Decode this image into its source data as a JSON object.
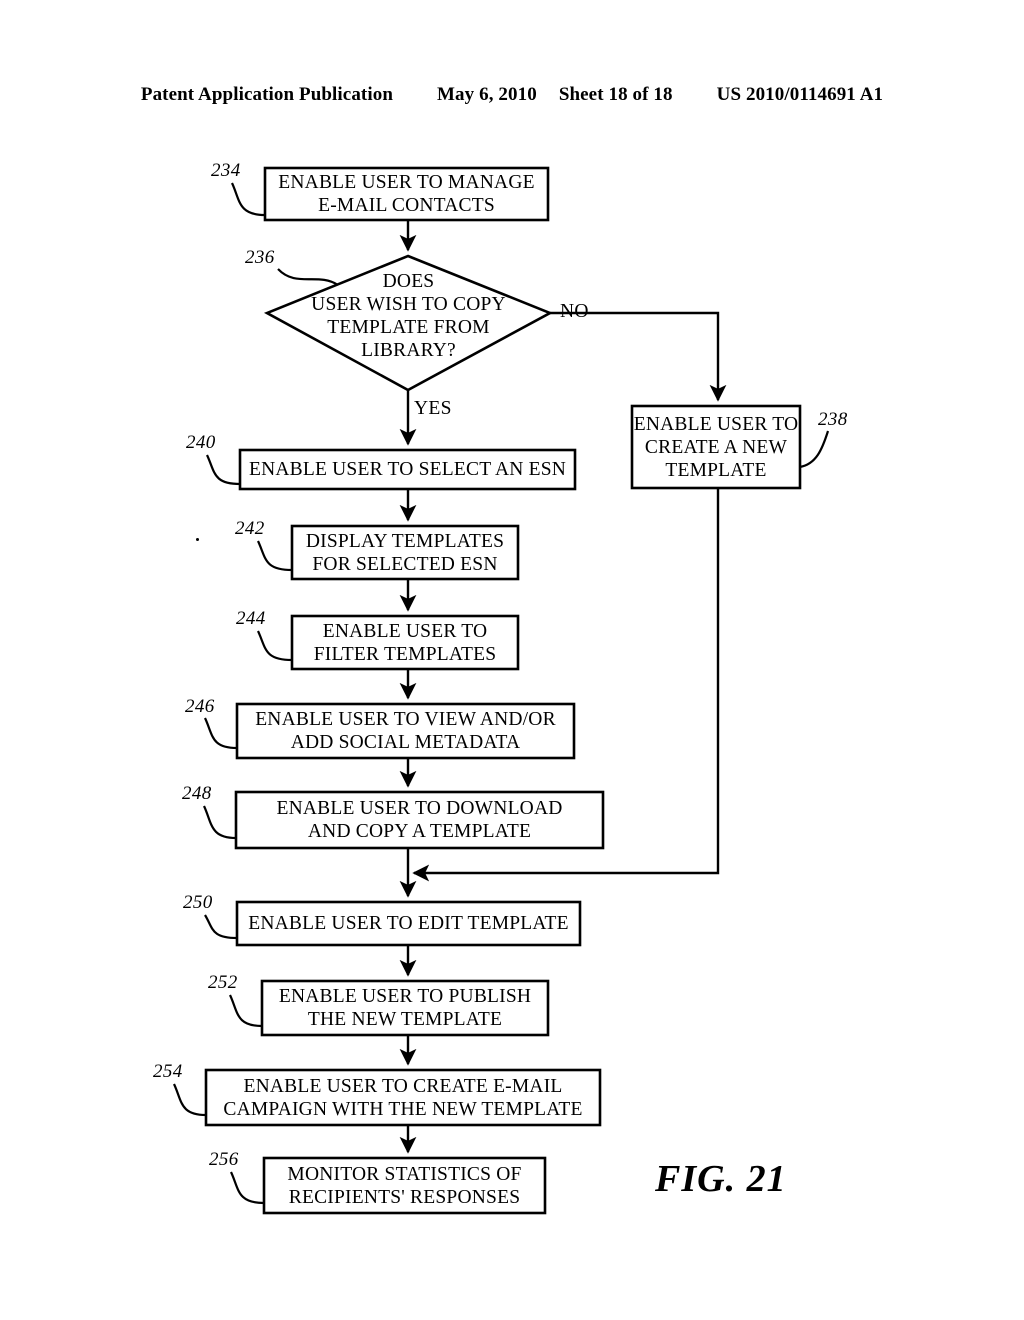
{
  "header": {
    "publication": "Patent Application Publication",
    "date": "May 6, 2010",
    "sheet": "Sheet 18 of 18",
    "patent_number": "US 2010/0114691 A1"
  },
  "figure": {
    "caption": "FIG. 21"
  },
  "flowchart": {
    "edge_labels": {
      "no": "NO",
      "yes": "YES"
    },
    "nodes": [
      {
        "ref": "234",
        "shape": "process",
        "lines": [
          "ENABLE USER TO MANAGE",
          "E-MAIL CONTACTS"
        ]
      },
      {
        "ref": "236",
        "shape": "decision",
        "lines": [
          "DOES",
          "USER WISH TO COPY",
          "TEMPLATE FROM",
          "LIBRARY?"
        ]
      },
      {
        "ref": "238",
        "shape": "process",
        "lines": [
          "ENABLE USER TO",
          "CREATE A NEW",
          "TEMPLATE"
        ]
      },
      {
        "ref": "240",
        "shape": "process",
        "lines": [
          "ENABLE USER TO SELECT AN ESN"
        ]
      },
      {
        "ref": "242",
        "shape": "process",
        "lines": [
          "DISPLAY TEMPLATES",
          "FOR SELECTED ESN"
        ]
      },
      {
        "ref": "244",
        "shape": "process",
        "lines": [
          "ENABLE USER TO",
          "FILTER TEMPLATES"
        ]
      },
      {
        "ref": "246",
        "shape": "process",
        "lines": [
          "ENABLE USER TO VIEW AND/OR",
          "ADD SOCIAL METADATA"
        ]
      },
      {
        "ref": "248",
        "shape": "process",
        "lines": [
          "ENABLE USER TO DOWNLOAD",
          "AND COPY A TEMPLATE"
        ]
      },
      {
        "ref": "250",
        "shape": "process",
        "lines": [
          "ENABLE USER TO EDIT TEMPLATE"
        ]
      },
      {
        "ref": "252",
        "shape": "process",
        "lines": [
          "ENABLE USER TO PUBLISH",
          "THE NEW TEMPLATE"
        ]
      },
      {
        "ref": "254",
        "shape": "process",
        "lines": [
          "ENABLE USER TO CREATE E-MAIL",
          "CAMPAIGN WITH THE NEW TEMPLATE"
        ]
      },
      {
        "ref": "256",
        "shape": "process",
        "lines": [
          "MONITOR STATISTICS OF",
          "RECIPIENTS' RESPONSES"
        ]
      }
    ]
  }
}
